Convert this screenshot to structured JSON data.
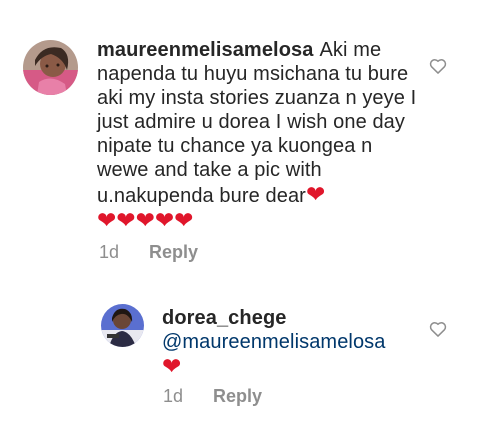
{
  "comments": [
    {
      "username": "maureenmelisamelosa",
      "text": "Aki me napenda tu huyu msichana tu bure aki my insta stories zuanza n yeye I just admire u dorea I wish one day nipate tu chance ya kuongea n wewe and take a pic with u.nakupenda bure dear",
      "trailing_heart": "❤",
      "hearts": [
        "❤",
        "❤",
        "❤",
        "❤",
        "❤"
      ],
      "time": "1d",
      "reply_label": "Reply"
    },
    {
      "username": "dorea_chege",
      "mention": "@maureenmelisamelosa",
      "hearts": [
        "❤"
      ],
      "time": "1d",
      "reply_label": "Reply"
    }
  ],
  "icons": {
    "like": "heart-outline-icon",
    "avatar_1": "avatar-photo",
    "avatar_2": "avatar-photo"
  },
  "colors": {
    "text": "#262626",
    "secondary": "#8e8e8e",
    "mention": "#00376b",
    "heart": "#e0162b"
  }
}
